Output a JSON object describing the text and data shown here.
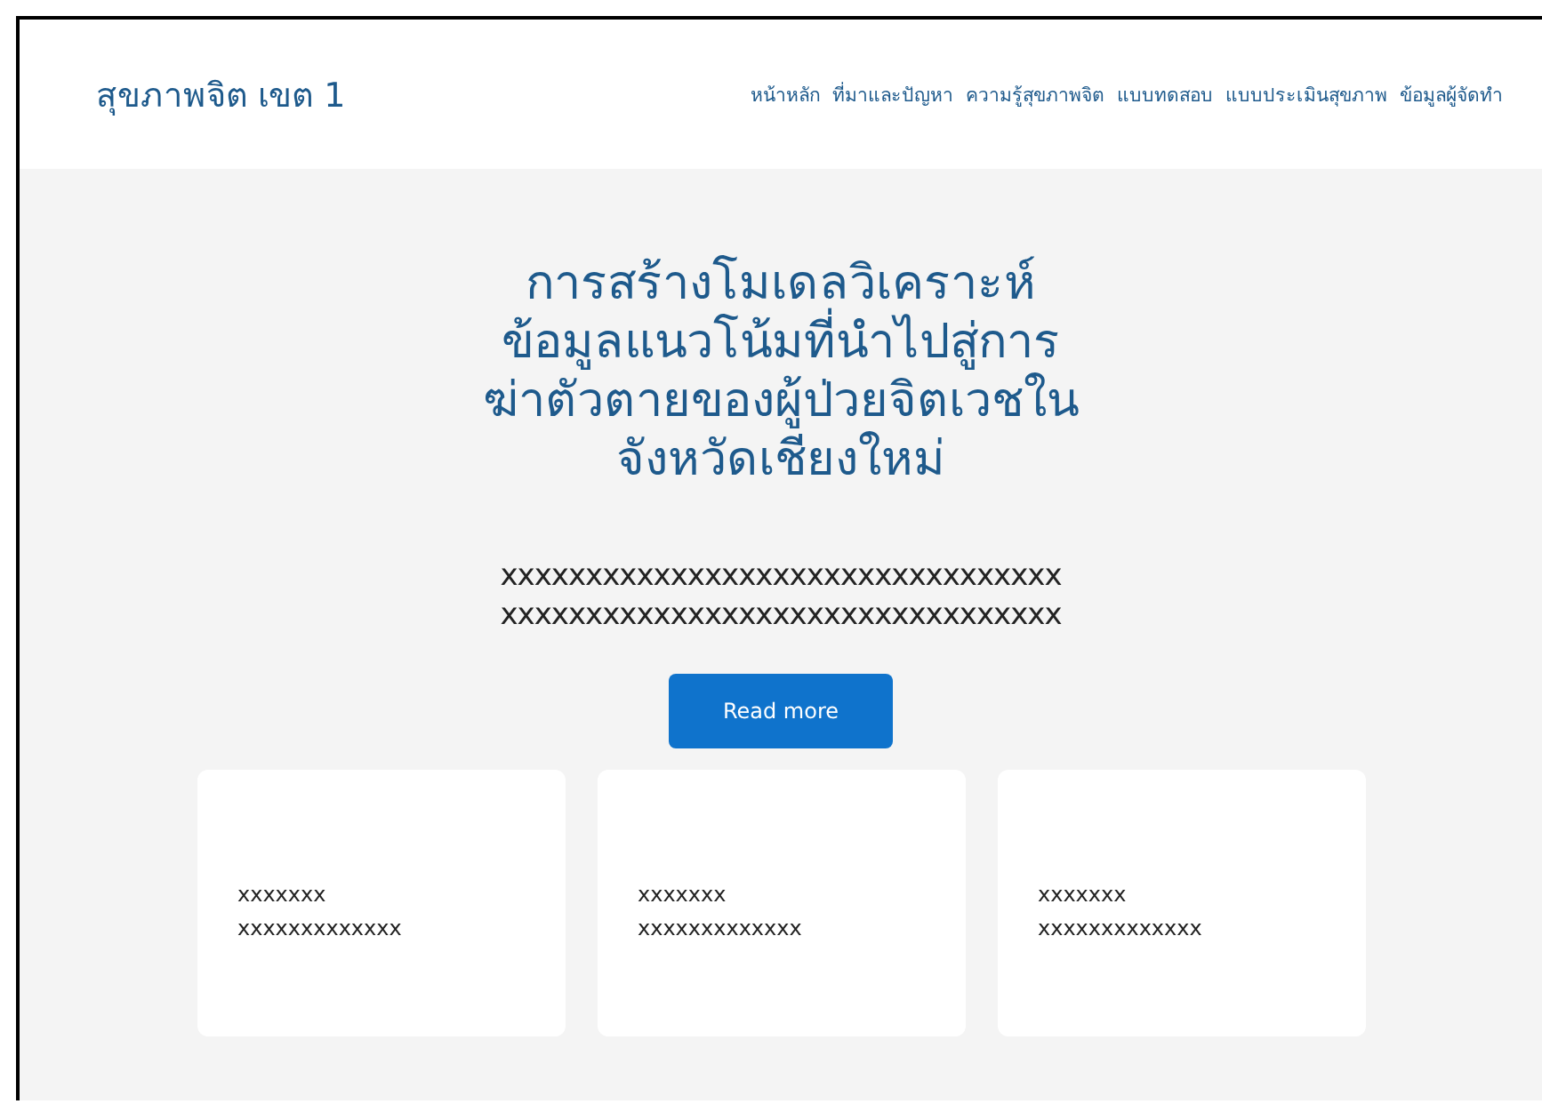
{
  "brand": "สุขภาพจิต เขต 1",
  "nav": [
    {
      "label": "หน้าหลัก"
    },
    {
      "label": "ที่มาและปัญหา"
    },
    {
      "label": "ความรู้สุขภาพจิต"
    },
    {
      "label": "แบบทดสอบ"
    },
    {
      "label": "แบบประเมินสุขภาพ"
    },
    {
      "label": "ข้อมูลผู้จัดทำ"
    }
  ],
  "hero": {
    "title_lines": [
      "การสร้างโมเดลวิเคราะห์",
      "ข้อมูลแนวโน้มที่นำไปสู่การ",
      "ฆ่าตัวตายของผู้ป่วยจิตเวชใน",
      "จังหวัดเชียงใหม่"
    ],
    "text_lines": [
      "xxxxxxxxxxxxxxxxxxxxxxxxxxxxxxxxx",
      "xxxxxxxxxxxxxxxxxxxxxxxxxxxxxxxxx"
    ],
    "button": "Read more"
  },
  "cards": [
    {
      "lines": [
        "xxxxxxx",
        "xxxxxxxxxxxxx"
      ]
    },
    {
      "lines": [
        "xxxxxxx",
        "xxxxxxxxxxxxx"
      ]
    },
    {
      "lines": [
        "xxxxxxx",
        "xxxxxxxxxxxxx"
      ]
    }
  ]
}
